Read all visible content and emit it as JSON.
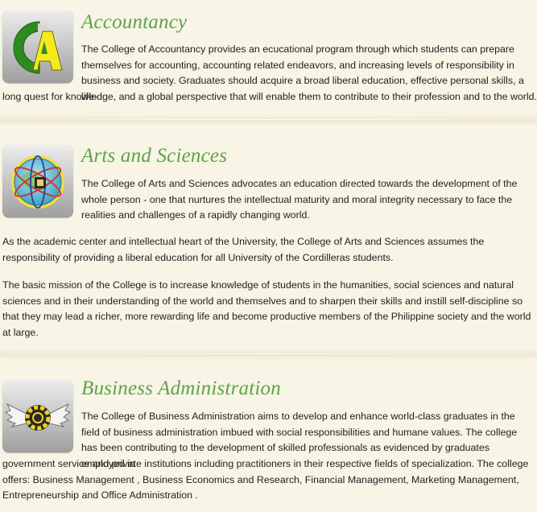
{
  "colleges": [
    {
      "title": "Accountancy",
      "icon": "accountancy-logo-icon",
      "para_lead": "The College of Accountancy provides an ecucational program through which students can prepare themselves for accounting, accounting related endeavors, and increasing levels of responsibility in business and society. Graduates should acquire a broad liberal education, effective personal skills, a life-",
      "para_rest": "long quest for knowledge, and a global perspective that will enable them to contribute to their profession and to the world."
    },
    {
      "title": "Arts and Sciences",
      "icon": "arts-and-sciences-logo-icon",
      "para_lead": "The College of Arts and Sciences advocates an education directed towards the development of the whole person - one that nurtures the intellectual maturity and moral integrity necessary to face the realities and challenges of a rapidly changing world.",
      "para_2": "As the academic center and intellectual heart of the University, the College of Arts and Sciences assumes the responsibility of providing a liberal education for all University of the Cordilleras students.",
      "para_3": "The basic mission of the College is to increase knowledge of students in the humanities, social sciences and natural sciences and in their understanding of the world and themselves and to sharpen their skills and instill self-discipline so that they may lead a richer, more rewarding life and become productive members of the Philippine society and the world at large."
    },
    {
      "title": "Business Administration",
      "icon": "business-administration-logo-icon",
      "para_lead": "The College of Business Administration aims to develop and enhance world-class graduates in the field of business administration imbued with social responsibilities and humane values. The college has been contributing to the development of skilled professionals as evidenced by graduates employed in",
      "para_rest": "government service and private institutions including practitioners in their respective fields of specialization. The college offers: Business Management , Business Economics and Research, Financial Management, Marketing Management, Entrepreneurship and Office Administration ."
    }
  ],
  "colors": {
    "background": "#f8f4e6",
    "title": "#5aa546",
    "text": "#222222"
  }
}
